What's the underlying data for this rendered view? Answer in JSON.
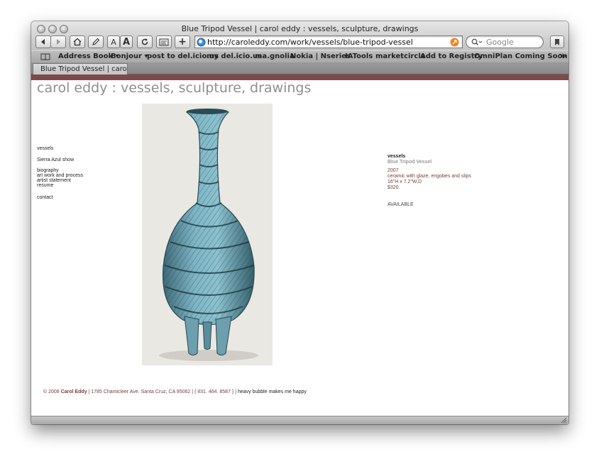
{
  "window": {
    "title": "Blue Tripod Vessel | carol eddy : vessels, sculpture, drawings"
  },
  "toolbar": {
    "back_icon": "back-arrow-icon",
    "forward_icon": "forward-arrow-icon",
    "home_icon": "home-icon",
    "edit_icon": "pencil-icon",
    "text_smaller_label": "A",
    "text_bigger_label": "A",
    "reload_icon": "reload-icon",
    "snapback_icon": "snapback-icon",
    "add_bookmark_label": "+",
    "url": "http://caroleddy.com/work/vessels/blue-tripod-vessel",
    "search_placeholder": "Google",
    "rss_icon": "rss-icon"
  },
  "bookmarks": {
    "items": [
      "Address Book ▾",
      "Bonjour ▾",
      "post to del.icio.us",
      "my del.icio.us",
      "ma.gnolia",
      "Nokia | Nseries",
      "IATools",
      "marketcircle",
      "Add to Registry",
      "OmniPlan Coming Soon!"
    ],
    "more_label": "≫"
  },
  "tabs": [
    {
      "label": "Blue Tripod Vessel | carol ..."
    }
  ],
  "site": {
    "title": "carol eddy : vessels, sculpture, drawings",
    "nav": [
      "vessels",
      "Sierra Azul show",
      "biography",
      "art work and process",
      "artist statement",
      "resume",
      "contact"
    ]
  },
  "artwork": {
    "category": "vessels",
    "name": "Blue Tripod Vessel",
    "year": "2007",
    "medium": "ceramic with glaze, engobes and slips",
    "dimensions": "16\"H x 7.2\"W,D",
    "price": "$320.",
    "availability": "AVAILABLE"
  },
  "footer": {
    "copyright": "© 2008",
    "owner": "Carol Eddy",
    "address": "| 1785 Chanticleer Ave. Santa Cruz, CA 95062 | { 831. 464. 8587 } |",
    "tagline": "heavy bubble makes me happy"
  },
  "colors": {
    "band": "#7d4a4a",
    "detail_text": "#7a3b3b",
    "vessel_blue": "#6fa6b7"
  }
}
